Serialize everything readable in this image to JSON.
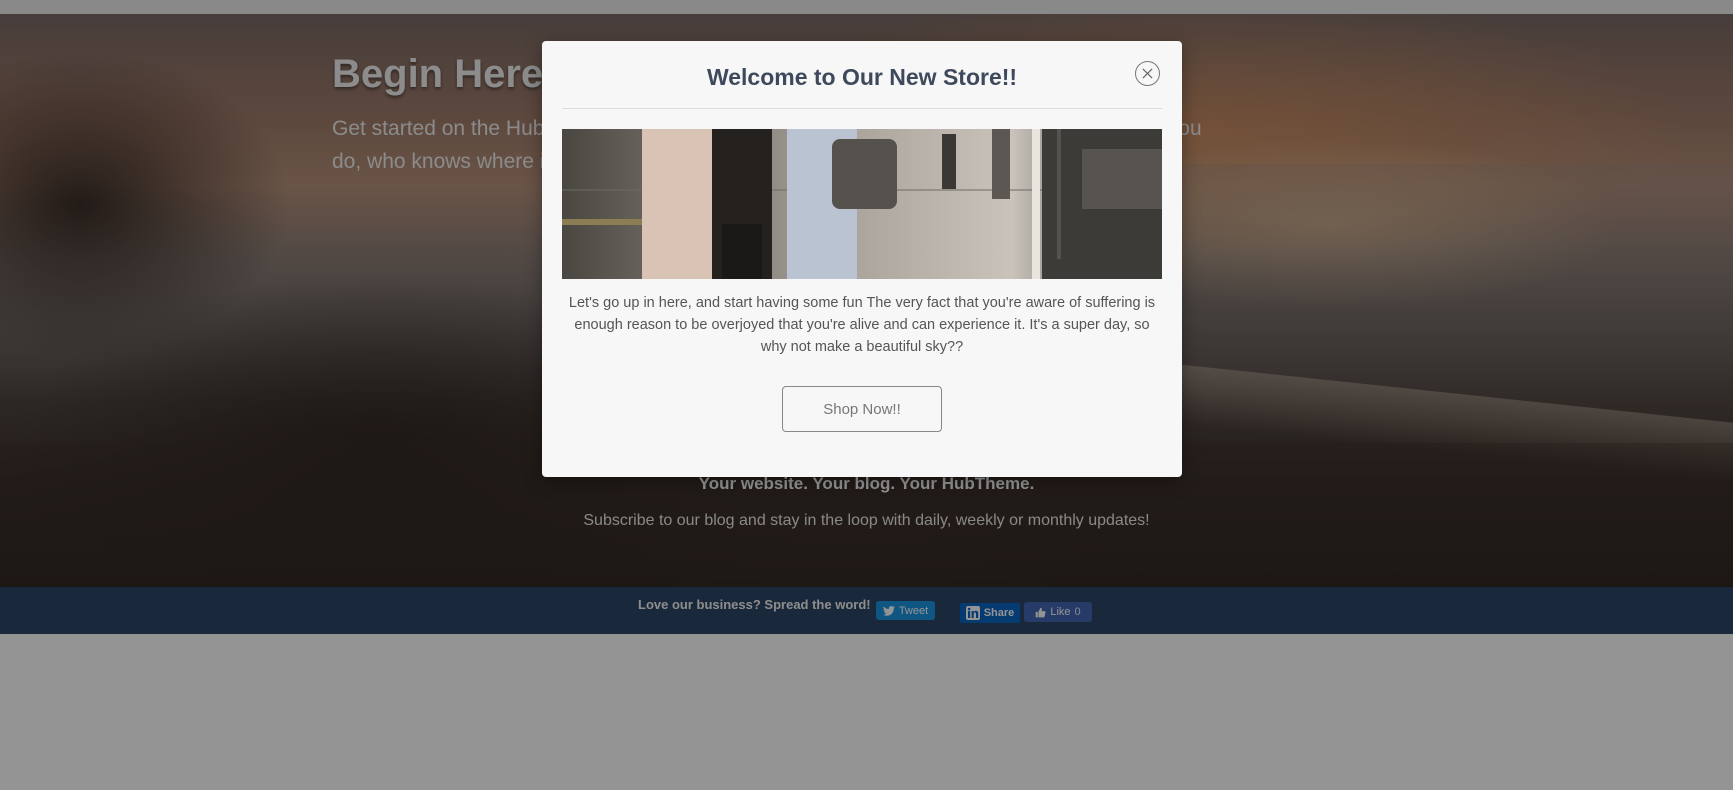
{
  "hero": {
    "title": "Begin Here",
    "text": "Get started on the HubTheme, the powerful theme. Customize it or code it by hand. Once you do, who knows where it might go.."
  },
  "subscribe": {
    "title": "Your website. Your blog. Your HubTheme.",
    "text": "Subscribe to our blog and stay in the loop with daily, weekly or monthly updates!"
  },
  "share": {
    "label": "Love our business?  Spread the word!",
    "tweet": "Tweet",
    "linkedin": "Share",
    "facebook_like": "Like",
    "facebook_count": "0"
  },
  "modal": {
    "title": "Welcome to Our New Store!!",
    "text": "Let's go up in here, and start having some fun The very fact that you're aware of suffering is enough reason to be overjoyed that you're alive and can experience it. It's a super day, so why not make a beautiful sky??",
    "button": "Shop Now!!",
    "close_icon": "close-icon",
    "image_alt": "couple walking on a city sidewalk"
  },
  "colors": {
    "tweet": "#1b95e0",
    "linkedin": "#0a66c2",
    "facebook": "#4267b2",
    "share_bar": "#2c4766",
    "modal_title": "#3e4a5c"
  }
}
